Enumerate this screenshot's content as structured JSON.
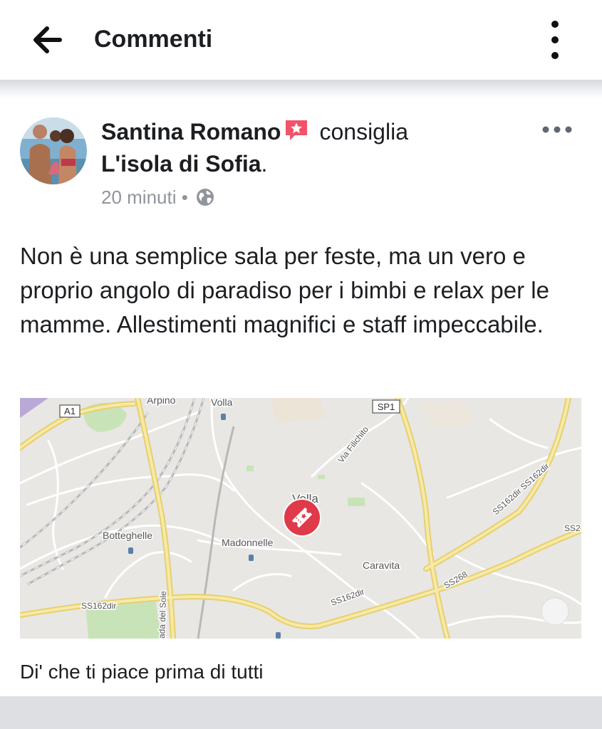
{
  "header": {
    "title": "Commenti",
    "back_icon": "arrow-left-icon",
    "menu_icon": "vertical-dots-icon"
  },
  "post": {
    "author": "Santina Romano",
    "action": "consiglia",
    "place": "L'isola di Sofia",
    "place_suffix": ".",
    "time": "20 minuti",
    "separator": "•",
    "privacy_icon": "globe-icon",
    "body": "Non è una semplice sala per feste, ma un vero e proprio angolo di paradiso per i bimbi e relax per le mamme. Allestimenti magnifici e staff impeccabile."
  },
  "map": {
    "labels": {
      "arpino": "Arpino",
      "volla_top": "Volla",
      "a1": "A1",
      "sp1": "SP1",
      "via_filichito": "Via Filichito",
      "volla_center": "Volla",
      "botteghelle": "Botteghelle",
      "madonnelle": "Madonnelle",
      "caravita": "Caravita",
      "ss162dir_left": "SS162dir",
      "ss162dir_mid": "SS162dir",
      "ss162dir_right": "SS162dir SS162dir",
      "ss268": "SS268",
      "ss2": "SS2",
      "strada_sole": "ada del Sole"
    },
    "pin_icon": "ticket-pin-icon",
    "accent": "#e0394a"
  },
  "footer": {
    "like_prompt": "Di' che ti piace prima di tutti"
  }
}
